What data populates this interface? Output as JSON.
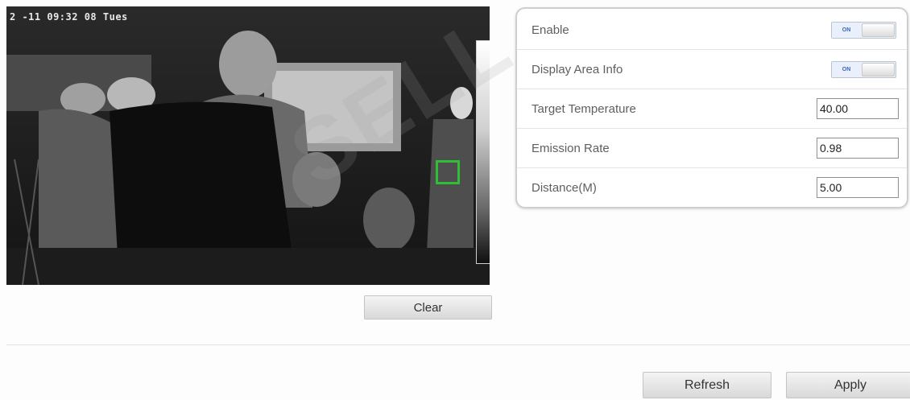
{
  "video": {
    "osd_text": "2     -11 09:32 08 Tues"
  },
  "buttons": {
    "clear": "Clear",
    "refresh": "Refresh",
    "apply": "Apply"
  },
  "settings": {
    "enable": {
      "label": "Enable",
      "state": "ON"
    },
    "display_area_info": {
      "label": "Display Area Info",
      "state": "ON"
    },
    "target_temperature": {
      "label": "Target Temperature",
      "value": "40.00"
    },
    "emission_rate": {
      "label": "Emission Rate",
      "value": "0.98"
    },
    "distance": {
      "label": "Distance(M)",
      "value": "5.00"
    }
  },
  "watermark": "SELL",
  "colors": {
    "target_box": "#2fbf36",
    "toggle_text": "#3a66b5"
  }
}
